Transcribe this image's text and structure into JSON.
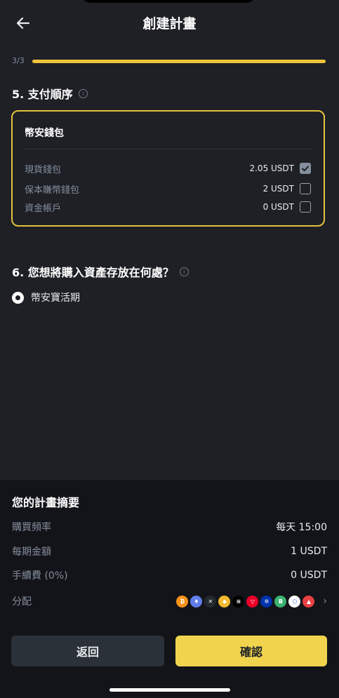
{
  "header": {
    "title": "創建計畫"
  },
  "progress": {
    "step_label": "3/3",
    "fraction": 1.0,
    "color": "#f0c33a"
  },
  "payment": {
    "section_title": "5. 支付順序",
    "card_title": "幣安錢包",
    "wallets": [
      {
        "name": "現貨錢包",
        "amount": "2.05 USDT",
        "checked": true
      },
      {
        "name": "保本賺幣錢包",
        "amount": "2 USDT",
        "checked": false
      },
      {
        "name": "資金帳戶",
        "amount": "0 USDT",
        "checked": false
      }
    ]
  },
  "storage": {
    "section_title": "6. 您想將購入資產存放在何處？",
    "option_label": "幣安寶活期"
  },
  "summary": {
    "title": "您的計畫摘要",
    "rows": [
      {
        "label": "購買頻率",
        "value": "每天 15:00"
      },
      {
        "label": "每期金額",
        "value": "1 USDT"
      },
      {
        "label": "手續費 (0%)",
        "value": "0 USDT"
      }
    ],
    "allocation_label": "分配",
    "coins": [
      {
        "icon": "bitcoin-icon",
        "color": "#f7931a",
        "glyph": "₿"
      },
      {
        "icon": "ethereum-icon",
        "color": "#627eea",
        "glyph": "♦"
      },
      {
        "icon": "xrp-icon",
        "color": "#23292f",
        "glyph": "✕"
      },
      {
        "icon": "bnb-icon",
        "color": "#f3ba2f",
        "glyph": "◆"
      },
      {
        "icon": "solana-icon",
        "color": "#000000",
        "glyph": "≡"
      },
      {
        "icon": "tron-icon",
        "color": "#eb0029",
        "glyph": "▽"
      },
      {
        "icon": "cardano-icon",
        "color": "#0033ad",
        "glyph": "✲"
      },
      {
        "icon": "bitcoin-cash-icon",
        "color": "#3cb371",
        "glyph": "Ƀ"
      },
      {
        "icon": "chainlink-icon",
        "color": "#2a5ada",
        "glyph": "⬡"
      },
      {
        "icon": "avalanche-icon",
        "color": "#e84142",
        "glyph": "▲"
      }
    ]
  },
  "buttons": {
    "back_label": "返回",
    "confirm_label": "確認"
  }
}
